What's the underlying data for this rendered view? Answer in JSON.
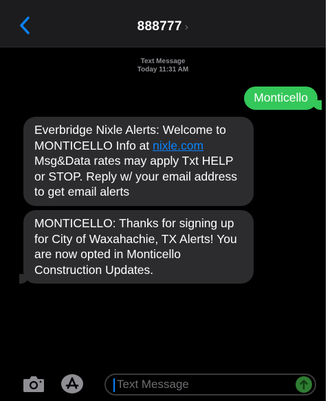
{
  "header": {
    "back_icon": "chevron-left-icon",
    "contact_name": "888777",
    "contact_chevron": "›"
  },
  "thread": {
    "service": "Text Message",
    "timestamp": "Today 11:31 AM",
    "messages": [
      {
        "direction": "sent",
        "text": "Monticello"
      },
      {
        "direction": "received",
        "text_before_link": "Everbridge Nixle Alerts: Welcome to MONTICELLO Info at ",
        "link": "nixle.com",
        "text_after_link": " Msg&Data rates may apply Txt HELP or STOP. Reply w/ your email address to get email alerts"
      },
      {
        "direction": "received",
        "text": "MONTICELLO: Thanks for signing up for City of Waxahachie, TX Alerts! You are now opted in Monticello Construction Updates."
      }
    ]
  },
  "composer": {
    "camera_icon": "camera-icon",
    "appstore_icon": "app-store-icon",
    "placeholder": "Text Message",
    "send_icon": "send-arrow-icon"
  },
  "colors": {
    "background": "#000000",
    "header": "#1c1c1e",
    "sent_bubble": "#34c759",
    "received_bubble": "#2c2c2e",
    "link": "#0a84ff",
    "accent": "#0a84ff"
  }
}
